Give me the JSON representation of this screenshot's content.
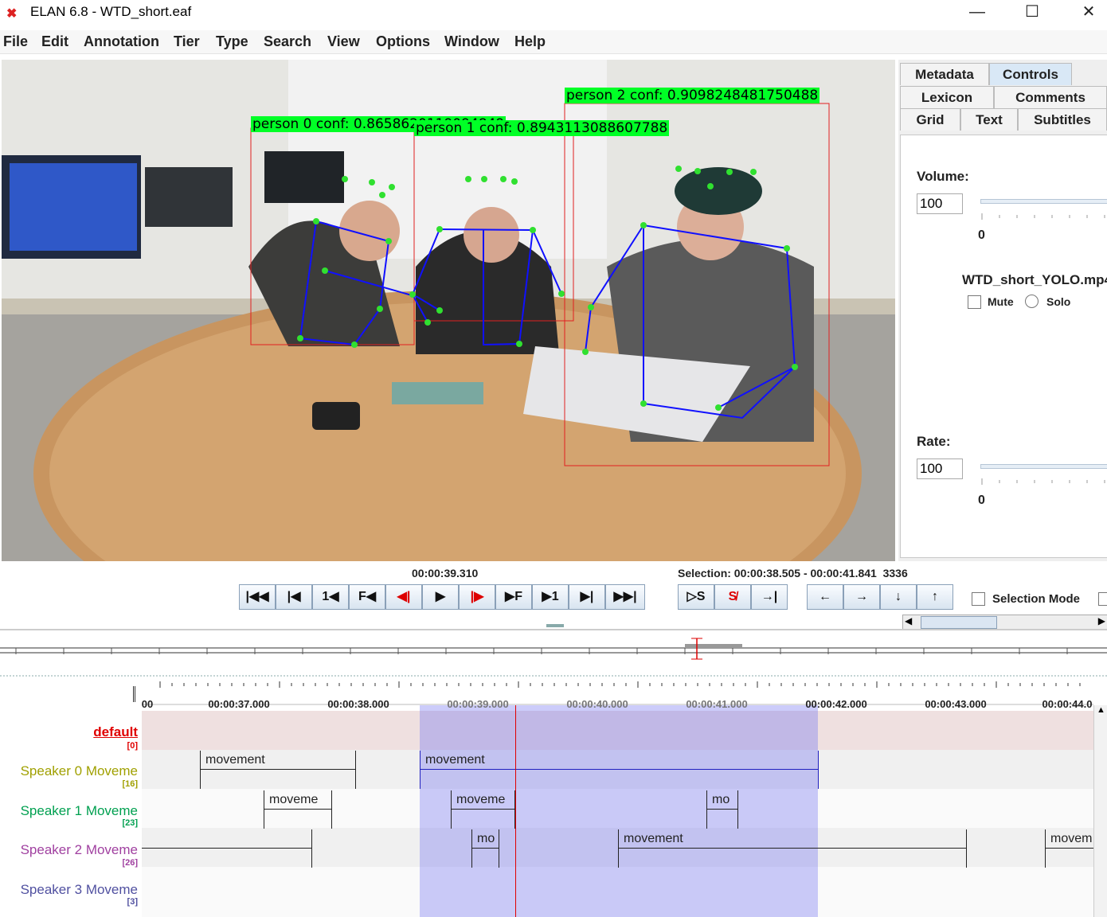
{
  "window": {
    "title": "ELAN 6.8 - WTD_short.eaf",
    "minimize": "—",
    "maximize": "☐",
    "close": "✕"
  },
  "menu": [
    "File",
    "Edit",
    "Annotation",
    "Tier",
    "Type",
    "Search",
    "View",
    "Options",
    "Window",
    "Help"
  ],
  "video": {
    "labels": [
      "person  0   conf:  0.8658620119094849",
      "person  1   conf:  0.8943113088607788",
      "person  2   conf:  0.9098248481750488"
    ]
  },
  "side_tabs": {
    "metadata": "Metadata",
    "controls": "Controls",
    "lexicon": "Lexicon",
    "comments": "Comments",
    "grid": "Grid",
    "text": "Text",
    "subtitles": "Subtitles"
  },
  "controls": {
    "volume_label": "Volume:",
    "volume_value": "100",
    "volume_min": "0",
    "media_file": "WTD_short_YOLO.mp4",
    "mute": "Mute",
    "solo": "Solo",
    "rate_label": "Rate:",
    "rate_value": "100",
    "rate_min": "0"
  },
  "player": {
    "current_time": "00:00:39.310",
    "selection": "Selection: 00:00:38.505 - 00:00:41.841  3336",
    "selection_mode": "Selection Mode"
  },
  "timeline": {
    "ticks": [
      "00",
      "00:00:37.000",
      "00:00:38.000",
      "00:00:39.000",
      "00:00:40.000",
      "00:00:41.000",
      "00:00:42.000",
      "00:00:43.000",
      "00:00:44.0"
    ],
    "tiers": [
      {
        "name": "default",
        "count": "[0]",
        "color": "#e00000"
      },
      {
        "name": "Speaker 0 Moveme",
        "count": "[16]",
        "color": "#a0a000"
      },
      {
        "name": "Speaker 1 Moveme",
        "count": "[23]",
        "color": "#00a050"
      },
      {
        "name": "Speaker 2 Moveme",
        "count": "[26]",
        "color": "#a040a0"
      },
      {
        "name": "Speaker 3 Moveme",
        "count": "[3]",
        "color": "#5050a0"
      }
    ],
    "annotations": [
      {
        "tier": 1,
        "text": "movement"
      },
      {
        "tier": 1,
        "text": "movement"
      },
      {
        "tier": 2,
        "text": "moveme"
      },
      {
        "tier": 2,
        "text": "moveme"
      },
      {
        "tier": 2,
        "text": "mo"
      },
      {
        "tier": 3,
        "text": ""
      },
      {
        "tier": 3,
        "text": "mo"
      },
      {
        "tier": 3,
        "text": "movement"
      },
      {
        "tier": 3,
        "text": "movem"
      }
    ]
  }
}
